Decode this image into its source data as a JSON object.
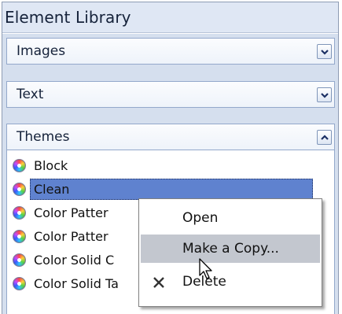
{
  "panel": {
    "title": "Element Library"
  },
  "sections": [
    {
      "label": "Images",
      "state": "collapsed",
      "toggle_icon": "chevron-down-icon"
    },
    {
      "label": "Text",
      "state": "collapsed",
      "toggle_icon": "chevron-down-icon"
    },
    {
      "label": "Themes",
      "state": "expanded",
      "toggle_icon": "chevron-up-icon"
    }
  ],
  "themes": {
    "items": [
      {
        "label": "Block",
        "icon": "theme-orb-icon"
      },
      {
        "label": "Clean",
        "icon": "theme-orb-icon",
        "selected": true
      },
      {
        "label": "Color Patter",
        "icon": "theme-orb-icon"
      },
      {
        "label": "Color Patter",
        "icon": "theme-orb-icon"
      },
      {
        "label": "Color Solid C",
        "icon": "theme-orb-icon"
      },
      {
        "label": "Color Solid Ta",
        "icon": "theme-orb-icon"
      }
    ]
  },
  "context_menu": {
    "items": [
      {
        "label": "Open"
      },
      {
        "label": "Make a Copy...",
        "highlighted": true
      },
      {
        "label": "Delete",
        "icon": "delete-x-icon"
      }
    ]
  },
  "colors": {
    "header_bg": "#dfe7f4",
    "selection": "#5f82cf",
    "menu_hover": "#c3c7cf",
    "border": "#93a8cb"
  }
}
